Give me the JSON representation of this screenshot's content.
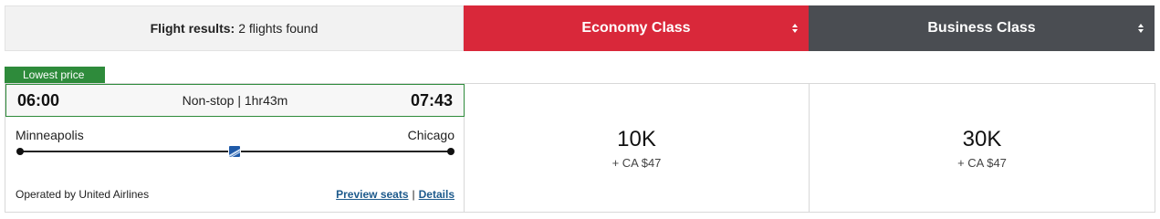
{
  "header": {
    "results_label": "Flight results:",
    "results_count": "2 flights found",
    "economy_tab": "Economy Class",
    "business_tab": "Business Class"
  },
  "flight": {
    "badge": "Lowest price",
    "depart_time": "06:00",
    "arrive_time": "07:43",
    "duration": "Non-stop | 1hr43m",
    "origin": "Minneapolis",
    "destination": "Chicago",
    "operated_by": "Operated by United Airlines",
    "preview_seats": "Preview seats",
    "separator": "|",
    "details": "Details",
    "airline_icon": "united-airlines-logo"
  },
  "fares": {
    "economy": {
      "points": "10K",
      "tax": "+ CA $47"
    },
    "business": {
      "points": "30K",
      "tax": "+ CA $47"
    }
  },
  "colors": {
    "economy": "#d9283a",
    "business": "#4a4d52",
    "lowest_price": "#2e8b3b",
    "link": "#1d5a8c"
  }
}
